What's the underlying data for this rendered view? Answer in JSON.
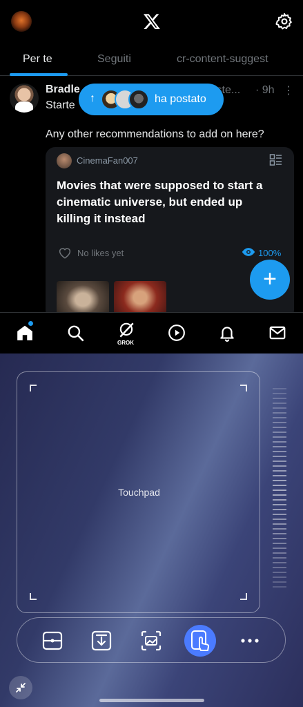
{
  "app": {
    "tabs": [
      {
        "label": "Per te",
        "active": true
      },
      {
        "label": "Seguiti",
        "active": false
      },
      {
        "label": "cr-content-suggest",
        "active": false
      }
    ],
    "post": {
      "author": "Bradle",
      "handle": "lste...",
      "time": "· 9h",
      "more": "⋮",
      "started": "Starte",
      "text": "Any other recommendations to add on here?",
      "card": {
        "user": "CinemaFan007",
        "title": "Movies that were supposed to start a cinematic universe, but ended up killing it instead",
        "likes": "No likes yet",
        "percent": "100%"
      }
    },
    "new_posts_pill": {
      "arrow": "↑",
      "label": "ha postato"
    },
    "fab_label": "+",
    "nav": {
      "grok_label": "GROK"
    },
    "colors": {
      "accent": "#1d9bf0",
      "background": "#000000"
    }
  },
  "panel": {
    "touchpad_label": "Touchpad",
    "tools": [
      "crop-icon",
      "download-icon",
      "screenshot-icon",
      "touch-icon",
      "more-icon"
    ],
    "active_tool": "touch-icon",
    "colors": {
      "active_tool": "#4b7bff"
    }
  }
}
